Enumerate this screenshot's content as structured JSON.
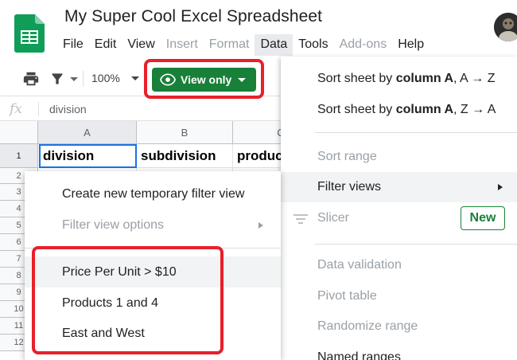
{
  "app": {
    "title": "My Super Cool Excel Spreadsheet",
    "logo_icon": "google-sheets-icon",
    "accent_color": "#188038"
  },
  "menubar": {
    "items": [
      {
        "label": "File",
        "enabled": true
      },
      {
        "label": "Edit",
        "enabled": true
      },
      {
        "label": "View",
        "enabled": true
      },
      {
        "label": "Insert",
        "enabled": false
      },
      {
        "label": "Format",
        "enabled": false
      },
      {
        "label": "Data",
        "enabled": true,
        "active": true
      },
      {
        "label": "Tools",
        "enabled": true
      },
      {
        "label": "Add-ons",
        "enabled": false
      },
      {
        "label": "Help",
        "enabled": true
      }
    ]
  },
  "toolbar": {
    "print_icon": "print-icon",
    "filter_icon": "filter-icon",
    "zoom": "100%",
    "view_only_label": "View only",
    "view_only_icon": "eye-icon"
  },
  "formula_bar": {
    "fx_label": "fx",
    "value": "division"
  },
  "grid": {
    "columns": [
      "A",
      "B",
      "C"
    ],
    "rows": [
      "1",
      "2",
      "3",
      "4",
      "5",
      "6",
      "7",
      "8",
      "9",
      "10",
      "11",
      "12"
    ],
    "row1": [
      "division",
      "subdivision",
      "product"
    ]
  },
  "data_menu": {
    "sort_az": {
      "prefix": "Sort sheet by ",
      "bold": "column A",
      "suffix": ", A → Z"
    },
    "sort_za": {
      "prefix": "Sort sheet by ",
      "bold": "column A",
      "suffix": ", Z → A"
    },
    "sort_range": "Sort range",
    "filter_views": "Filter views",
    "slicer": "Slicer",
    "new_badge": "New",
    "data_validation": "Data validation",
    "pivot_table": "Pivot table",
    "randomize_range": "Randomize range",
    "named_ranges": "Named ranges"
  },
  "filter_views_menu": {
    "create_temp": "Create new temporary filter view",
    "options": "Filter view options",
    "saved_views": [
      "Price Per Unit > $10",
      "Products 1 and 4",
      "East and West"
    ]
  }
}
